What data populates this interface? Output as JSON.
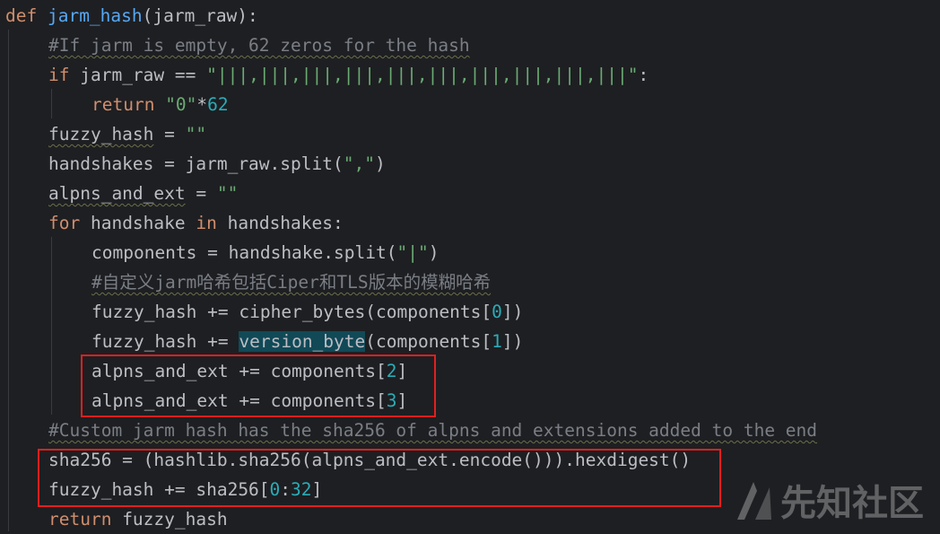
{
  "editor": {
    "lines": [
      {
        "parts": [
          [
            "kw",
            "def "
          ],
          [
            "fn",
            "jarm_hash"
          ],
          [
            "",
            "(jarm_raw):"
          ]
        ]
      },
      {
        "parts": [
          [
            "cm wavy",
            "#If jarm is empty, 62 zeros for the hash"
          ]
        ]
      },
      {
        "parts": [
          [
            "kw",
            "if "
          ],
          [
            "",
            "jarm_raw == "
          ],
          [
            "str",
            "\"|||,|||,|||,|||,|||,|||,|||,|||,|||,|||\""
          ],
          [
            "",
            ":"
          ]
        ]
      },
      {
        "parts": [
          [
            "kw",
            "return "
          ],
          [
            "str",
            "\"0\""
          ],
          [
            "",
            "*"
          ],
          [
            "num",
            "62"
          ]
        ]
      },
      {
        "parts": [
          [
            "wavy",
            "fuzzy_hash"
          ],
          [
            "",
            " = "
          ],
          [
            "str",
            "\"\""
          ]
        ]
      },
      {
        "parts": [
          [
            "",
            "handshakes = jarm_raw.split("
          ],
          [
            "str",
            "\",\""
          ],
          [
            "",
            ")"
          ]
        ]
      },
      {
        "parts": [
          [
            "wavy",
            "alpns_and_ext"
          ],
          [
            "",
            " = "
          ],
          [
            "str",
            "\"\""
          ]
        ]
      },
      {
        "parts": [
          [
            "kw",
            "for "
          ],
          [
            "",
            "handshake "
          ],
          [
            "kw",
            "in "
          ],
          [
            "",
            "handshakes:"
          ]
        ]
      },
      {
        "parts": [
          [
            "",
            "components = handshake.split("
          ],
          [
            "str",
            "\"|\""
          ],
          [
            "",
            ")"
          ]
        ]
      },
      {
        "parts": [
          [
            "cm wavy",
            "#自定义jarm哈希包括Ciper和TLS版本的模糊哈希"
          ]
        ]
      },
      {
        "parts": [
          [
            "",
            "fuzzy_hash += "
          ],
          [
            "fn-plain",
            "cipher_bytes"
          ],
          [
            "",
            "(components["
          ],
          [
            "num",
            "0"
          ],
          [
            "",
            "])"
          ]
        ]
      },
      {
        "parts": [
          [
            "",
            "fuzzy_hash += "
          ],
          [
            "hl",
            "version_byte"
          ],
          [
            "",
            "(components["
          ],
          [
            "num",
            "1"
          ],
          [
            "",
            "])"
          ]
        ]
      },
      {
        "parts": [
          [
            "",
            "alpns_and_ext += components["
          ],
          [
            "num",
            "2"
          ],
          [
            "",
            "]"
          ]
        ]
      },
      {
        "parts": [
          [
            "",
            "alpns_and_ext += components["
          ],
          [
            "num",
            "3"
          ],
          [
            "",
            "]"
          ]
        ]
      },
      {
        "parts": [
          [
            "cm wavy",
            "#Custom jarm hash has the sha256 of alpns and extensions added to the end"
          ]
        ]
      },
      {
        "parts": [
          [
            "",
            "sha256 = (hashlib.sha256(alpns_and_ext.encode())).hexdigest()"
          ]
        ]
      },
      {
        "parts": [
          [
            "",
            "fuzzy_hash += sha256["
          ],
          [
            "num",
            "0"
          ],
          [
            "",
            ":"
          ],
          [
            "num",
            "32"
          ],
          [
            "",
            "]"
          ]
        ]
      },
      {
        "parts": [
          [
            "kw",
            "return "
          ],
          [
            "",
            "fuzzy_hash"
          ]
        ]
      }
    ]
  },
  "watermark": {
    "text": "先知社区",
    "icon": "xz-logo-icon"
  },
  "colors": {
    "background": "#1e1f22",
    "keyword": "#cf8e6d",
    "function": "#56a8f5",
    "string": "#6aab73",
    "number": "#2aacb8",
    "comment": "#7a7e85",
    "highlight_box": "#e0201f"
  }
}
